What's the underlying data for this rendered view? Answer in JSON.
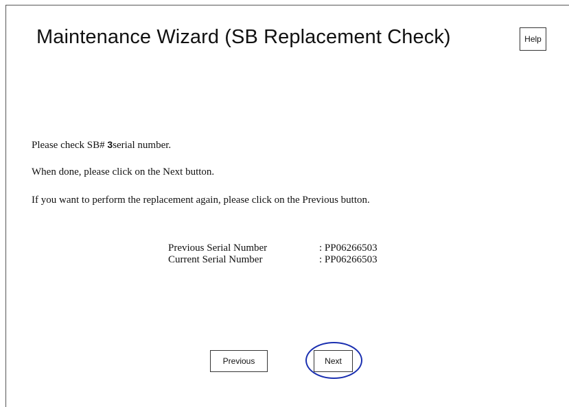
{
  "header": {
    "title": "Maintenance Wizard (SB Replacement Check)",
    "help_label": "Help"
  },
  "instructions": {
    "line1_prefix": "Please check SB# ",
    "sb_number": "3",
    "line1_suffix": "serial number.",
    "line2": "When done, please click on the Next button.",
    "line3": "If you want to perform the replacement again, please click on the Previous button."
  },
  "serials": [
    {
      "label": "Previous Serial Number",
      "value": ": PP06266503"
    },
    {
      "label": "Current Serial Number",
      "value": ": PP06266503"
    }
  ],
  "footer": {
    "previous_label": "Previous",
    "next_label": "Next"
  },
  "colors": {
    "highlight_ring": "#1a2fb0"
  }
}
